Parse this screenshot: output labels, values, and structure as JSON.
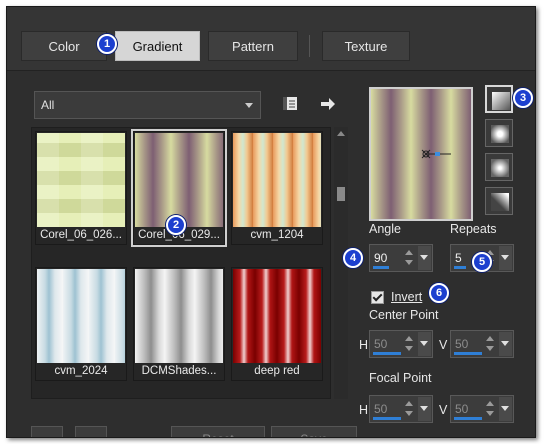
{
  "tabs": [
    {
      "label": "Color"
    },
    {
      "label": "Gradient"
    },
    {
      "label": "Pattern"
    },
    {
      "label": "Texture"
    }
  ],
  "filter": {
    "value": "All"
  },
  "swatches": [
    {
      "label": "Corel_06_026..."
    },
    {
      "label": "Corel_06_029..."
    },
    {
      "label": "cvm_1204"
    },
    {
      "label": "cvm_2024"
    },
    {
      "label": "DCMShades..."
    },
    {
      "label": "deep red"
    }
  ],
  "selected_swatch": "Corel_06_029...",
  "angle": {
    "label": "Angle",
    "value": "90"
  },
  "repeats": {
    "label": "Repeats",
    "value": "5"
  },
  "invert": {
    "label": "Invert",
    "checked": true
  },
  "center_point": {
    "label": "Center Point",
    "h_label": "H",
    "h_value": "50",
    "v_label": "V",
    "v_value": "50"
  },
  "focal_point": {
    "label": "Focal Point",
    "h_label": "H",
    "h_value": "50",
    "v_label": "V",
    "v_value": "50"
  },
  "bottom_buttons": [
    {
      "label": ""
    },
    {
      "label": ""
    },
    {
      "label": "Reset"
    },
    {
      "label": "Save"
    }
  ],
  "badges": [
    "1",
    "2",
    "3",
    "4",
    "5",
    "6"
  ],
  "colors": {
    "badge": "#1c3fcf",
    "accent_bar": "#2f7fd6",
    "panel_bg": "#2e2e2e"
  },
  "icons": {
    "library": "library-icon",
    "arrow": "arrow-right-icon",
    "style_linear": "linear-gradient-icon",
    "style_rect": "rectangular-gradient-icon",
    "style_radial": "radial-gradient-icon",
    "style_sunburst": "sunburst-gradient-icon"
  }
}
